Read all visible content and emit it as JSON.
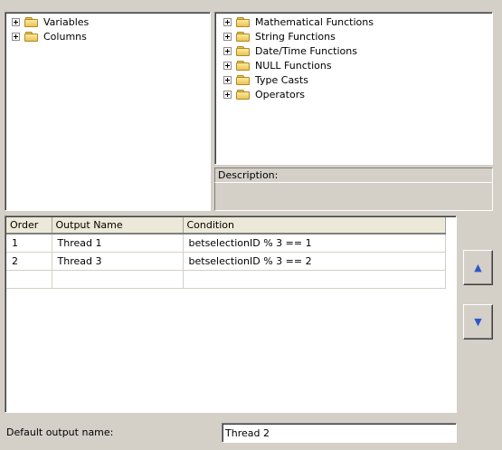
{
  "left_tree": {
    "items": [
      {
        "label": "Variables"
      },
      {
        "label": "Columns"
      }
    ]
  },
  "right_tree": {
    "items": [
      {
        "label": "Mathematical Functions"
      },
      {
        "label": "String Functions"
      },
      {
        "label": "Date/Time Functions"
      },
      {
        "label": "NULL Functions"
      },
      {
        "label": "Type Casts"
      },
      {
        "label": "Operators"
      }
    ]
  },
  "description": {
    "label": "Description:",
    "text": ""
  },
  "grid": {
    "columns": [
      "Order",
      "Output Name",
      "Condition"
    ],
    "rows": [
      {
        "order": "1",
        "name": "Thread 1",
        "condition": "betselectionID % 3 == 1"
      },
      {
        "order": "2",
        "name": "Thread 3",
        "condition": "betselectionID % 3 == 2"
      }
    ]
  },
  "buttons": {
    "move_up_icon": "up-arrow",
    "move_down_icon": "down-arrow"
  },
  "footer": {
    "label": "Default output name:",
    "value": "Thread 2"
  },
  "colors": {
    "window_bg": "#d4d0c8",
    "arrow_blue": "#2e58c8"
  }
}
